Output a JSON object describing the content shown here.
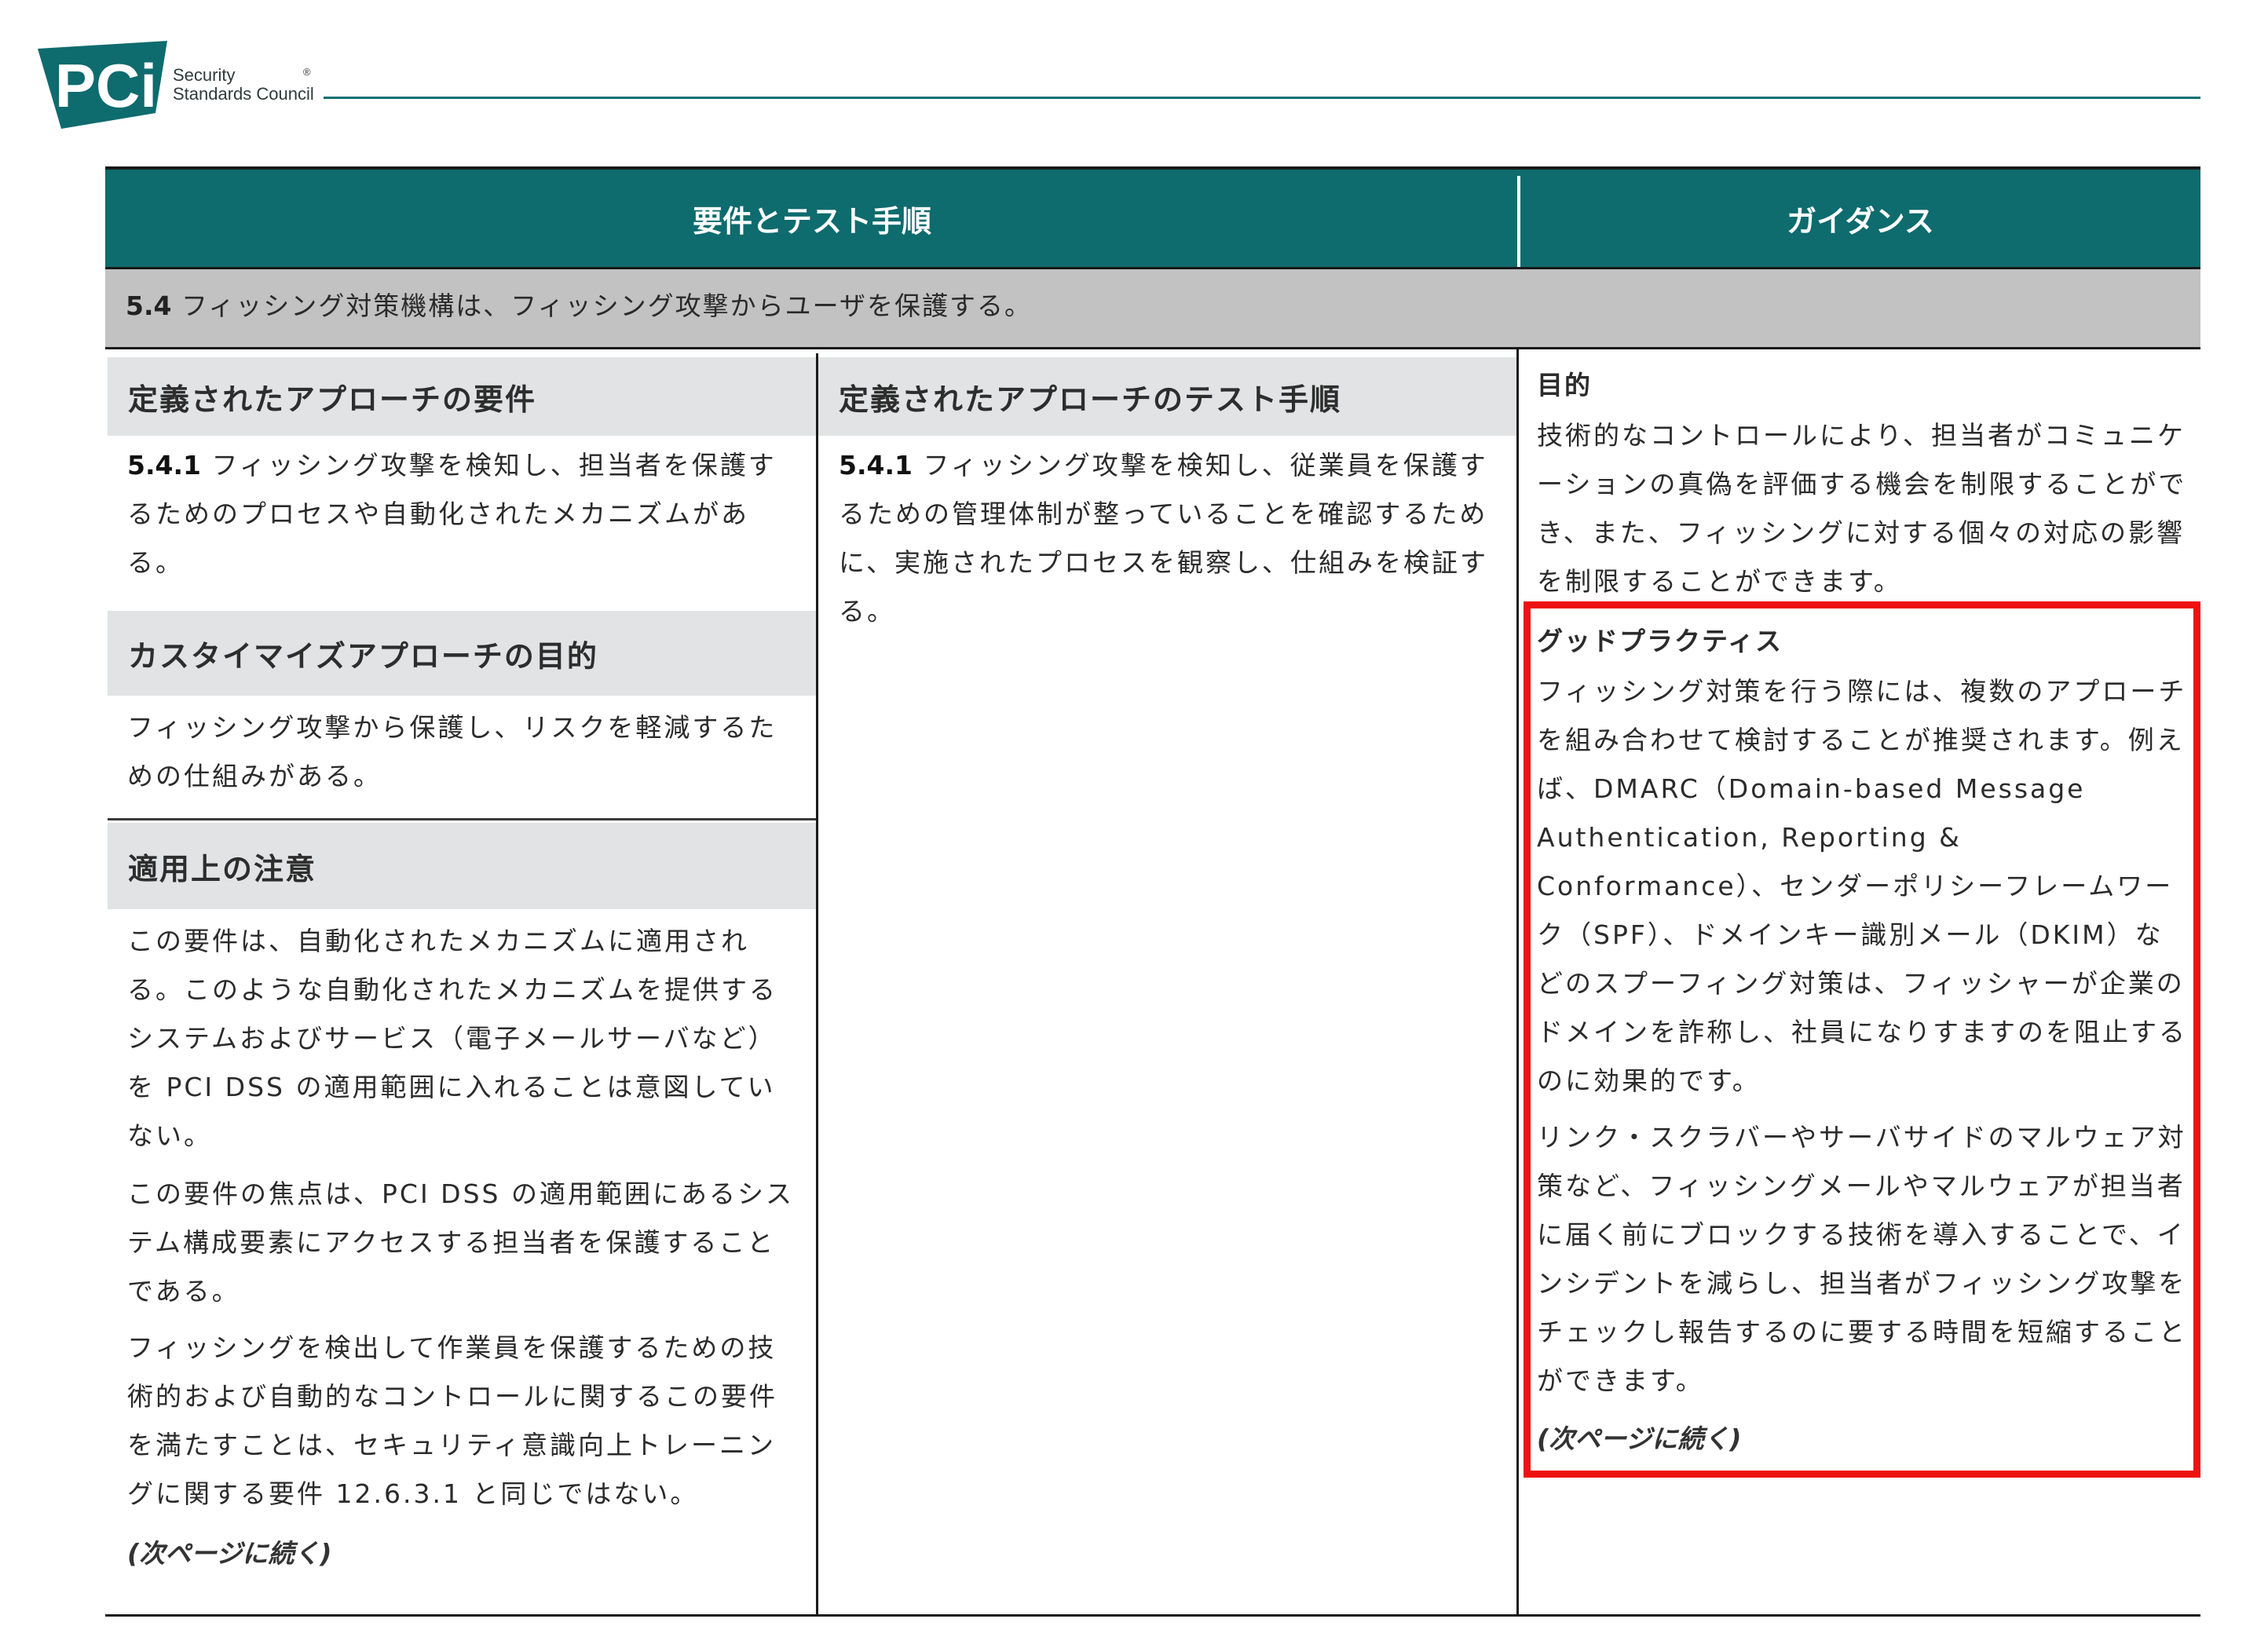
{
  "header": {
    "logo_mark": "PCi",
    "logo_line1": "Security",
    "logo_line2": "Standards Council",
    "logo_reg": "®"
  },
  "table": {
    "col_header_left": "要件とテスト手順",
    "col_header_right": "ガイダンス",
    "section_number": "5.4",
    "section_text": " フィッシング対策機構は、フィッシング攻撃からユーザを保護する。"
  },
  "left": {
    "defined_req_title": "定義されたアプローチの要件",
    "req_number": "5.4.1",
    "req_text": " フィッシング攻撃を検知し、担当者を保護するためのプロセスや自動化されたメカニズムがある。",
    "custom_title": "カスタイマイズアプローチの目的",
    "custom_text": "フィッシング攻撃から保護し、リスクを軽減するための仕組みがある。",
    "notes_title": "適用上の注意",
    "notes_p1": "この要件は、自動化されたメカニズムに適用される。このような自動化されたメカニズムを提供するシステムおよびサービス（電子メールサーバなど）を PCI DSS の適用範囲に入れることは意図していない。",
    "notes_p2": "この要件の焦点は、PCI DSS の適用範囲にあるシステム構成要素にアクセスする担当者を保護することである。",
    "notes_p3": "フィッシングを検出して作業員を保護するための技術的および自動的なコントロールに関するこの要件を満たすことは、セキュリティ意識向上トレーニングに関する要件 12.6.3.1 と同じではない。",
    "continued": "(次ページに続く)"
  },
  "middle": {
    "test_title": "定義されたアプローチのテスト手順",
    "test_number": "5.4.1",
    "test_text": " フィッシング攻撃を検知し、従業員を保護するための管理体制が整っていることを確認するために、実施されたプロセスを観察し、仕組みを検証する。"
  },
  "guidance": {
    "purpose_title": "目的",
    "purpose_text": "技術的なコントロールにより、担当者がコミュニケーションの真偽を評価する機会を制限することができ、また、フィッシングに対する個々の対応の影響を制限することができます。",
    "good_practice_title": "グッドプラクティス",
    "gp_p1": "フィッシング対策を行う際には、複数のアプローチを組み合わせて検討することが推奨されます。例えば、DMARC（Domain-based Message Authentication, Reporting & Conformance）、センダーポリシーフレームワーク（SPF）、ドメインキー識別メール（DKIM）などのスプーフィング対策は、フィッシャーが企業のドメインを詐称し、社員になりすますのを阻止するのに効果的です。",
    "gp_p2": "リンク・スクラバーやサーバサイドのマルウェア対策など、フィッシングメールやマルウェアが担当者に届く前にブロックする技術を導入することで、インシデントを減らし、担当者がフィッシング攻撃をチェックし報告するのに要する時間を短縮することができます。",
    "continued": "(次ページに続く)"
  },
  "colors": {
    "header_teal": "#0e6b6e",
    "section_grey": "#c2c2c2",
    "subhead_grey": "#e1e3e4",
    "highlight_red": "#ee1111"
  }
}
